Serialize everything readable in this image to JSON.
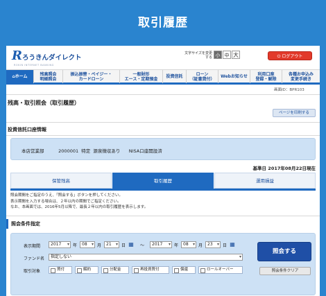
{
  "page_title": "取引履歴",
  "header": {
    "logo_mark": "R",
    "logo_text": "ろうきんダイレクト",
    "logo_sub": "ROKIN INTERNET BANKING",
    "font_size_label": "文字サイズを変更する",
    "font_sizes": [
      "小",
      "中",
      "大"
    ],
    "logout": "ログアウト"
  },
  "nav": [
    {
      "label": "ホーム",
      "icon": "home-icon"
    },
    {
      "label": "残高照会\n明細照会"
    },
    {
      "label": "振込振替・ペイジー・\nカードローン"
    },
    {
      "label": "一般財形\nエース・定期預金"
    },
    {
      "label": "投資信託"
    },
    {
      "label": "ローン\n（証書貸付）"
    },
    {
      "label": "Webお知らせ"
    },
    {
      "label": "利用口座\n登録・解除"
    },
    {
      "label": "各種お申込み\n変更手続き"
    }
  ],
  "screen_id": "画面ID：BPR103",
  "heading": "残高・取引照会（取引履歴）",
  "print_button": "ページを印刷する",
  "account_section": "投資信託口座情報",
  "account_line": "本店営業部          2000001  特定  源泉徴収あり      NISA口座開設済",
  "base_date": "基準日 2017年08月22日現在",
  "tabs": [
    "保管残高",
    "取引履歴",
    "運用損益"
  ],
  "notice_lines": [
    "照会期間をご指定のうえ、「照会する」ボタンを押してください。",
    "表示期間を入力する場合は、２年以内の期間でご指定ください。",
    "なお、本画面では、2016年5月以降で、最長２年以内の取引履歴を表示します。"
  ],
  "search_section": "照会条件指定",
  "search": {
    "period_label": "表示期間",
    "from": {
      "year": "2017",
      "month": "08",
      "day": "21"
    },
    "to": {
      "year": "2017",
      "month": "08",
      "day": "23"
    },
    "unit_year": "年",
    "unit_month": "月",
    "unit_day": "日",
    "tilde": "～",
    "fund_label": "ファンド名",
    "fund_value": "指定しない",
    "type_label": "取引対象",
    "types": [
      "買付",
      "解約",
      "分配金",
      "再投資買付",
      "償還",
      "ロールオーバー"
    ],
    "submit": "照会する",
    "clear": "照会条件クリア"
  },
  "colors": {
    "primary": "#1f6ac0",
    "background": "#2a84cf",
    "logout": "#e23a2b",
    "panel": "#cde1f5"
  }
}
